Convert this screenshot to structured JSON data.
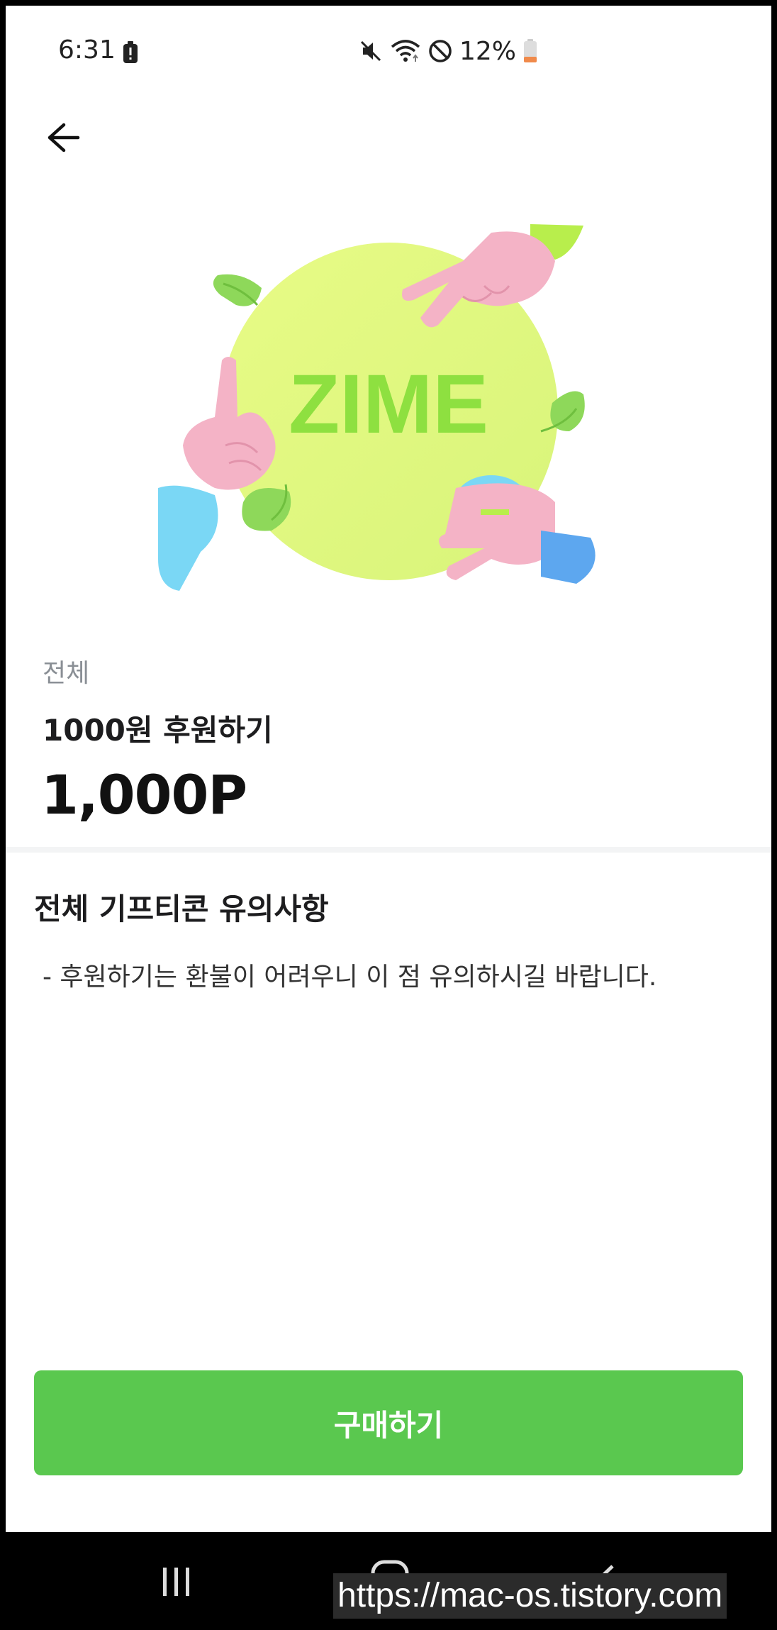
{
  "status_bar": {
    "time": "6:31",
    "battery_percent": "12%",
    "icons": [
      "battery-alert-icon",
      "mute-icon",
      "wifi-icon",
      "do-not-disturb-icon",
      "battery-icon"
    ]
  },
  "header": {
    "back_icon": "arrow-left-icon"
  },
  "product": {
    "image_logo_text": "ZIME",
    "category": "전체",
    "name": "1000원 후원하기",
    "price": "1,000P"
  },
  "notice": {
    "title": "전체 기프티콘 유의사항",
    "body": "- 후원하기는 환불이 어려우니 이 점 유의하시길 바랍니다."
  },
  "actions": {
    "buy_label": "구매하기"
  },
  "nav_bar": {
    "icons": [
      "recent-apps-icon",
      "home-icon",
      "back-icon"
    ]
  },
  "watermark": "https://mac-os.tistory.com",
  "colors": {
    "accent": "#5ac84f",
    "circle": "#dff97e",
    "logo_green": "#8ee040",
    "hand_pink": "#f4b3c6",
    "sleeve_blue": "#7ad7f5"
  }
}
